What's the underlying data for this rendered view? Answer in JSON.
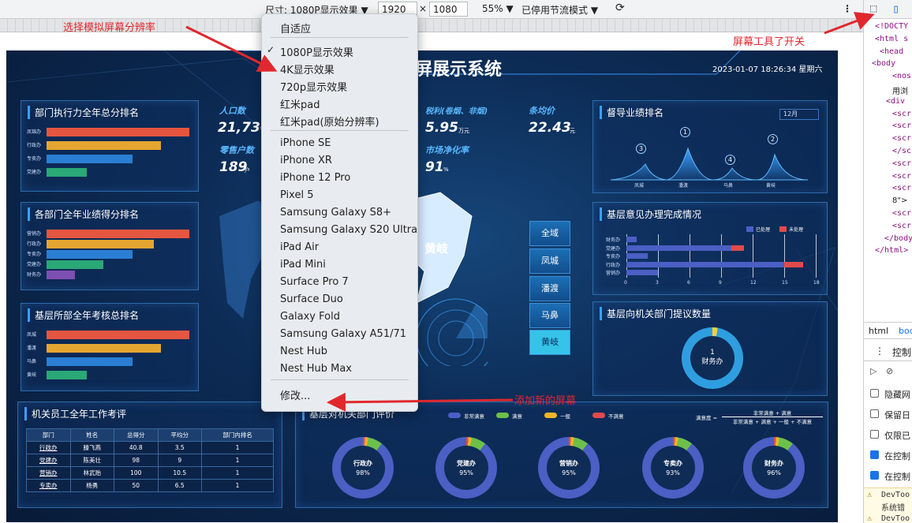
{
  "toolbar": {
    "size_label": "尺寸: 1080P显示效果 ▼",
    "width": "1920",
    "times": "×",
    "height": "1080",
    "zoom": "55% ▼",
    "throttle": "已停用节流模式 ▼"
  },
  "menu": {
    "group1": [
      "自适应"
    ],
    "group2": [
      "1080P显示效果",
      "4K显示效果",
      "720p显示效果",
      "红米pad",
      "红米pad(原始分辨率)"
    ],
    "group3": [
      "iPhone SE",
      "iPhone XR",
      "iPhone 12 Pro",
      "Pixel 5",
      "Samsung Galaxy S8+",
      "Samsung Galaxy S20 Ultra",
      "iPad Air",
      "iPad Mini",
      "Surface Pro 7",
      "Surface Duo",
      "Galaxy Fold",
      "Samsung Galaxy A51/71",
      "Nest Hub",
      "Nest Hub Max"
    ],
    "edit": "修改...",
    "check": "✓"
  },
  "annotations": {
    "select": "选择模拟屏幕分辨率",
    "toggle": "屏幕工具了开关",
    "add": "添加新的屏幕"
  },
  "dashboard": {
    "title": "屏展示系统",
    "datetime": "2023-01-07 18:26:34 星期六",
    "stats": {
      "pop_label": "人口数",
      "pop_value": "21,736",
      "retail_label": "零售户数",
      "retail_value": "189",
      "retail_unit": "户",
      "tax_label": "税利(卷烟、非烟)",
      "tax_value": "5.95",
      "tax_unit": "万元",
      "price_label": "条均价",
      "price_value": "22.43",
      "price_unit": "元",
      "purify_label": "市场净化率",
      "purify_value": "91",
      "purify_unit": "%"
    },
    "map_label": "黄岐",
    "cities": [
      "全域",
      "凤城",
      "潘渡",
      "马鼻",
      "黄岐"
    ],
    "p1": {
      "title": "部门执行力全年总分排名",
      "rows": [
        "凤锦办",
        "行政办",
        "专卖办",
        "党建办"
      ],
      "values": [
        100,
        80,
        60,
        28
      ]
    },
    "p2": {
      "title": "各部门全年业绩得分排名",
      "rows": [
        "营销办",
        "行政办",
        "专卖办",
        "党建办",
        "财务办"
      ],
      "values": [
        100,
        75,
        60,
        40,
        20
      ]
    },
    "p3": {
      "title": "基层所部全年考核总排名",
      "rows": [
        "凤城",
        "潘渡",
        "马鼻",
        "黄岐"
      ],
      "values": [
        100,
        80,
        60,
        28
      ]
    },
    "p4": {
      "title": "督导业绩排名",
      "select": "12月",
      "places": [
        "凤城",
        "潘渡",
        "马鼻",
        "黄岐"
      ],
      "ranks": [
        "3",
        "1",
        "4",
        "2"
      ]
    },
    "p5": {
      "title": "基层意见办理完成情况",
      "legend": [
        "已处理",
        "未处理"
      ],
      "rows": [
        "财务办",
        "党建办",
        "专卖办",
        "行政办",
        "营销办"
      ],
      "done": [
        1,
        10,
        2,
        15,
        3
      ],
      "undone": [
        0,
        1.2,
        0,
        1.8,
        0
      ],
      "ticks": [
        "0",
        "3",
        "6",
        "9",
        "12",
        "15",
        "18"
      ]
    },
    "p6": {
      "title": "基层向机关部门提议数量",
      "value": "1",
      "label": "财务办"
    },
    "p7": {
      "title": "机关员工全年工作考评",
      "headers": [
        "部门",
        "姓名",
        "总得分",
        "平均分",
        "部门内排名"
      ],
      "rows": [
        [
          "行政办",
          "滕飞燕",
          "40.8",
          "3.5",
          "1"
        ],
        [
          "党建办",
          "陈美壮",
          "98",
          "9",
          "1"
        ],
        [
          "营销办",
          "林武贻",
          "100",
          "10.5",
          "1"
        ],
        [
          "专卖办",
          "杨勇",
          "50",
          "6.5",
          "1"
        ]
      ]
    },
    "p8": {
      "title": "基层对机关部门评价",
      "legend": [
        "非常满意",
        "满意",
        "一般",
        "不满意"
      ],
      "formula_label": "满意度 =",
      "formula_num": "非常满意 + 满意",
      "formula_den": "非常满意 + 满意 + 一般 + 不满意",
      "rings": [
        {
          "name": "行政办",
          "pct": "98%"
        },
        {
          "name": "党建办",
          "pct": "95%"
        },
        {
          "name": "营销办",
          "pct": "95%"
        },
        {
          "name": "专卖办",
          "pct": "93%"
        },
        {
          "name": "财务办",
          "pct": "96%"
        }
      ]
    }
  },
  "devtools": {
    "lines": [
      "<!DOCTY",
      "<html s",
      "<head",
      "<body",
      "<nos",
      "用浏",
      "<div",
      "<scr",
      "<scr",
      "<scr",
      "</sc",
      "<scr",
      "<scr",
      "<scr",
      "8\">",
      "<scr",
      "<scr",
      "</body",
      "</html>"
    ],
    "tabs": [
      "html",
      "bod"
    ],
    "console": "控制",
    "options": [
      "隐藏网",
      "保留日",
      "仅限已",
      "在控制",
      "在控制"
    ],
    "warn": [
      "DevToo",
      "系统错",
      "DevToo"
    ]
  },
  "colors": {
    "bars": [
      "#e55640",
      "#e4a630",
      "#2a7fd4",
      "#2aa876",
      "#7d4fb2"
    ],
    "legend4": [
      "#4b5fc4",
      "#6cc04a",
      "#f0b429",
      "#e04b4b"
    ]
  }
}
